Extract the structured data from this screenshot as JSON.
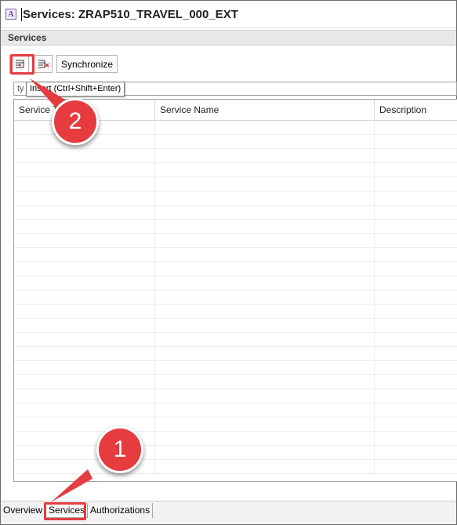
{
  "window": {
    "title": "Services: ZRAP510_TRAVEL_000_EXT",
    "app_icon": "A"
  },
  "section": {
    "title": "Services"
  },
  "toolbar": {
    "insert_icon": "insert-row-icon",
    "delete_icon": "delete-row-icon",
    "synchronize_label": "Synchronize"
  },
  "tooltip": {
    "text": "Insert (Ctrl+Shift+Enter)"
  },
  "filter": {
    "value": "ty"
  },
  "table": {
    "columns": [
      "Service Type",
      "Service Name",
      "Description"
    ],
    "rows": []
  },
  "tabs": {
    "items": [
      "Overview",
      "Services",
      "Authorizations"
    ],
    "active": "Services"
  },
  "callouts": {
    "first": "1",
    "second": "2"
  },
  "colors": {
    "highlight": "#e63c40",
    "header_bg": "#e8e8e8"
  }
}
